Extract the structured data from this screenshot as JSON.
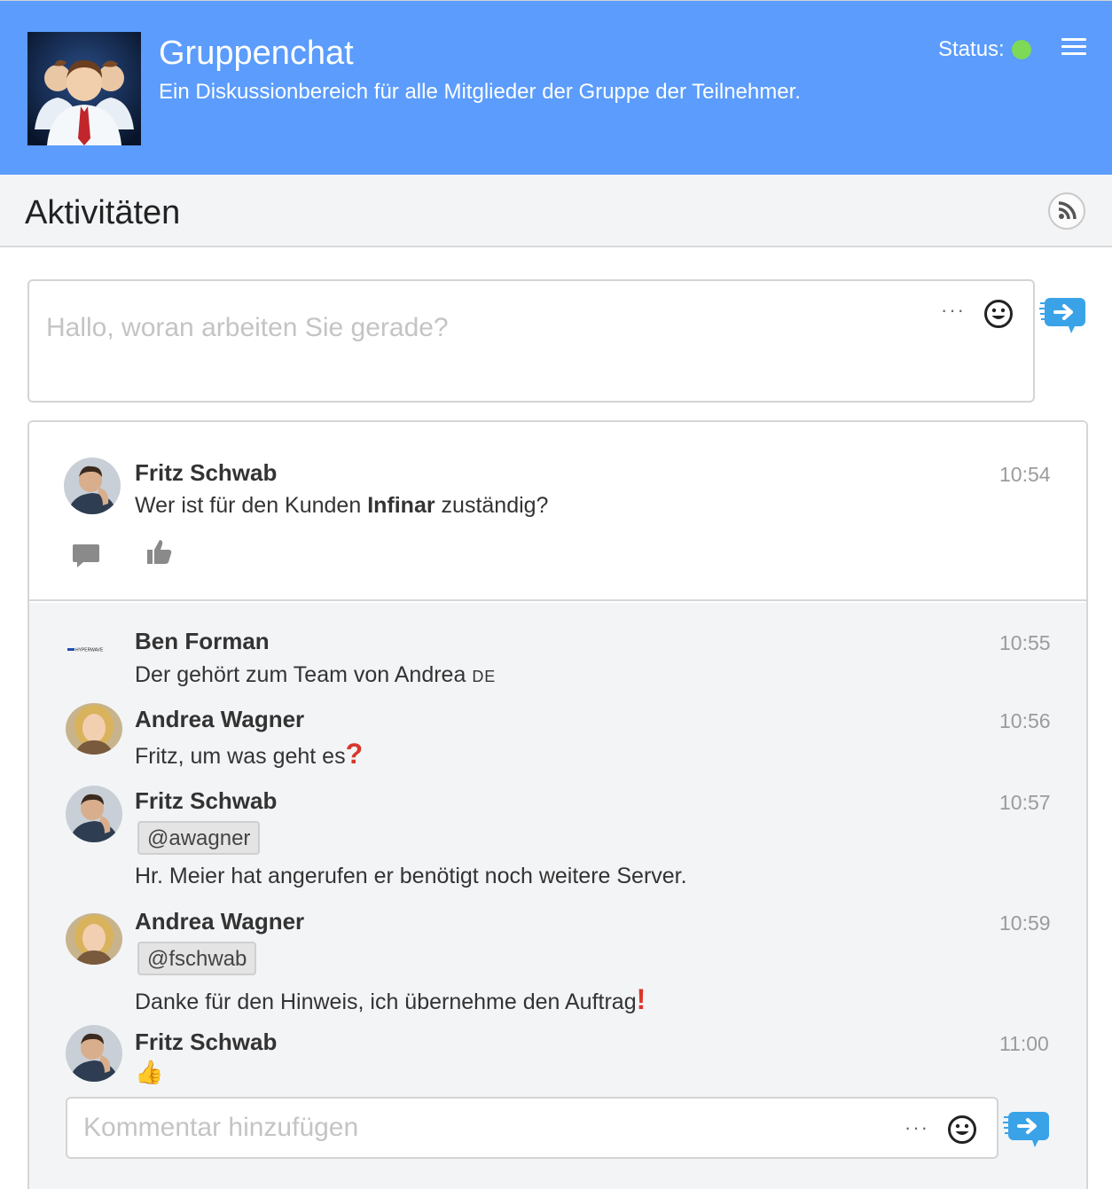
{
  "header": {
    "title": "Gruppenchat",
    "subtitle": "Ein Diskussionbereich für alle Mitglieder der Gruppe der Teilnehmer.",
    "status_label": "Status:",
    "status_color": "#7ed957",
    "bg_color": "#5b9cfc"
  },
  "activities": {
    "title": "Aktivitäten"
  },
  "compose": {
    "placeholder": "Hallo, woran arbeiten Sie gerade?",
    "more_label": "···"
  },
  "post": {
    "author": "Fritz Schwab",
    "time": "10:54",
    "text_before": "Wer ist für den Kunden ",
    "text_bold": "Infinar",
    "text_after": " zuständig?"
  },
  "replies": [
    {
      "author": "Ben Forman",
      "time": "10:55",
      "text": "Der gehört zum Team von Andrea",
      "tag": "DE",
      "avatar_text": "HYPERWAVE"
    },
    {
      "author": "Andrea Wagner",
      "time": "10:56",
      "text": "Fritz, um was geht es",
      "emoji": "?"
    },
    {
      "author": "Fritz Schwab",
      "time": "10:57",
      "mention": "@awagner",
      "text": "Hr. Meier hat angerufen er benötigt noch weitere Server."
    },
    {
      "author": "Andrea Wagner",
      "time": "10:59",
      "mention": "@fschwab",
      "text": "Danke für den Hinweis, ich übernehme den Auftrag",
      "emoji": "!"
    },
    {
      "author": "Fritz Schwab",
      "time": "11:00",
      "emoji": "👍"
    }
  ],
  "comment": {
    "placeholder": "Kommentar hinzufügen",
    "more_label": "···"
  },
  "icons": {
    "menu": "hamburger-menu-icon",
    "rss": "rss-icon",
    "smiley": "smiley-icon",
    "send": "send-message-icon",
    "comment": "comment-icon",
    "like": "thumbs-up-icon"
  }
}
